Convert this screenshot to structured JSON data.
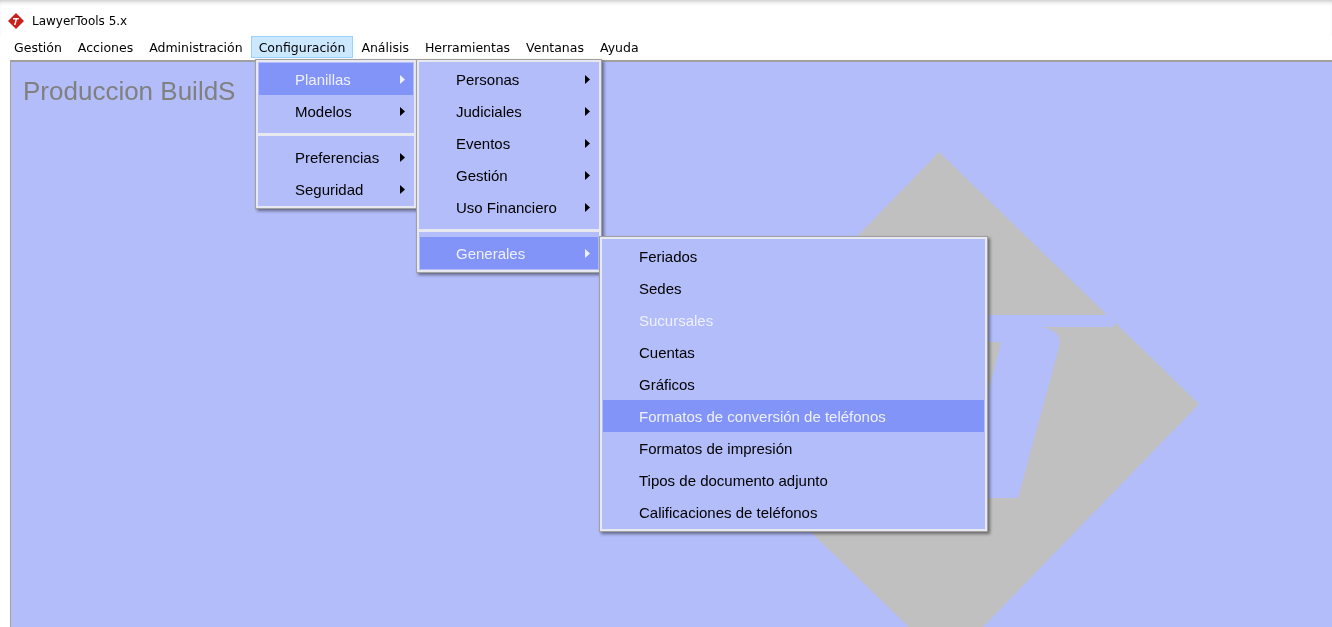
{
  "window": {
    "title": "LawyerTools 5.x"
  },
  "menubar": [
    {
      "label": "Gestión",
      "selected": false
    },
    {
      "label": "Acciones",
      "selected": false
    },
    {
      "label": "Administración",
      "selected": false
    },
    {
      "label": "Configuración",
      "selected": true
    },
    {
      "label": "Análisis",
      "selected": false
    },
    {
      "label": "Herramientas",
      "selected": false
    },
    {
      "label": "Ventanas",
      "selected": false
    },
    {
      "label": "Ayuda",
      "selected": false
    }
  ],
  "workspace": {
    "heading": "Produccion BuildS"
  },
  "menus": [
    {
      "items": [
        {
          "kind": "item",
          "label": "Planillas",
          "submenu": true,
          "selected": true,
          "disabled": false
        },
        {
          "kind": "item",
          "label": "Modelos",
          "submenu": true,
          "selected": false,
          "disabled": false
        },
        {
          "kind": "separator"
        },
        {
          "kind": "item",
          "label": "Preferencias",
          "submenu": true,
          "selected": false,
          "disabled": false
        },
        {
          "kind": "item",
          "label": "Seguridad",
          "submenu": true,
          "selected": false,
          "disabled": false
        }
      ]
    },
    {
      "items": [
        {
          "kind": "item",
          "label": "Personas",
          "submenu": true,
          "selected": false,
          "disabled": false
        },
        {
          "kind": "item",
          "label": "Judiciales",
          "submenu": true,
          "selected": false,
          "disabled": false
        },
        {
          "kind": "item",
          "label": "Eventos",
          "submenu": true,
          "selected": false,
          "disabled": false
        },
        {
          "kind": "item",
          "label": "Gestión",
          "submenu": true,
          "selected": false,
          "disabled": false
        },
        {
          "kind": "item",
          "label": "Uso Financiero",
          "submenu": true,
          "selected": false,
          "disabled": false
        },
        {
          "kind": "separator"
        },
        {
          "kind": "item",
          "label": "Generales",
          "submenu": true,
          "selected": true,
          "disabled": false
        }
      ]
    },
    {
      "items": [
        {
          "kind": "item",
          "label": "Feriados",
          "submenu": false,
          "selected": false,
          "disabled": false
        },
        {
          "kind": "item",
          "label": "Sedes",
          "submenu": false,
          "selected": false,
          "disabled": false
        },
        {
          "kind": "item",
          "label": "Sucursales",
          "submenu": false,
          "selected": false,
          "disabled": true
        },
        {
          "kind": "item",
          "label": "Cuentas",
          "submenu": false,
          "selected": false,
          "disabled": false
        },
        {
          "kind": "item",
          "label": "Gráficos",
          "submenu": false,
          "selected": false,
          "disabled": false
        },
        {
          "kind": "item",
          "label": "Formatos de conversión de teléfonos",
          "submenu": false,
          "selected": true,
          "disabled": false
        },
        {
          "kind": "item",
          "label": "Formatos de impresión",
          "submenu": false,
          "selected": false,
          "disabled": false
        },
        {
          "kind": "item",
          "label": "Tipos de documento adjunto",
          "submenu": false,
          "selected": false,
          "disabled": false
        },
        {
          "kind": "item",
          "label": "Calificaciones de teléfonos",
          "submenu": false,
          "selected": false,
          "disabled": false
        }
      ]
    }
  ]
}
